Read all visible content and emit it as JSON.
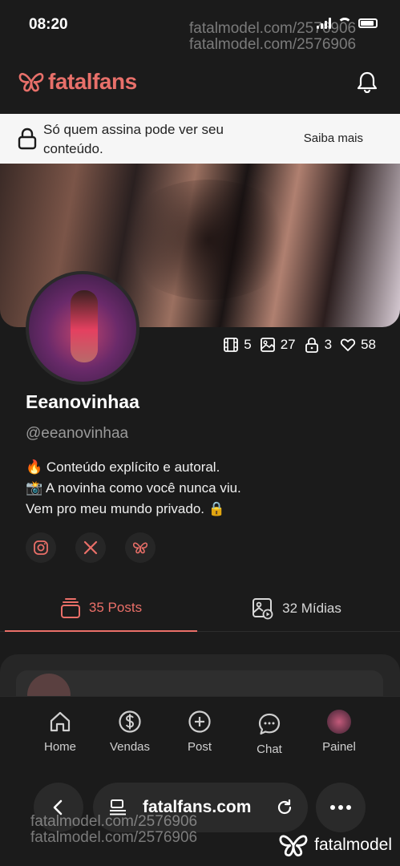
{
  "status_bar": {
    "time": "08:20"
  },
  "watermark": {
    "top_text": "fatalmodel.com/2576906",
    "bottom_text": "fatalmodel.com/2576906"
  },
  "header": {
    "logo_text": "fatalfans"
  },
  "lock_banner": {
    "text": "Só quem assina pode ver seu conteúdo.",
    "action": "Saiba mais"
  },
  "stats": {
    "videos": "5",
    "photos": "27",
    "locked": "3",
    "likes": "58"
  },
  "profile": {
    "name": "Eeanovinhaa",
    "handle": "@eeanovinhaa",
    "bio": [
      "🔥 Conteúdo explícito e autoral.",
      "📸 A novinha como você nunca viu.",
      "Vem pro meu mundo privado. 🔒"
    ]
  },
  "tabs": {
    "posts": "35 Posts",
    "midias": "32 Mídias"
  },
  "bottom_nav": {
    "home": "Home",
    "vendas": "Vendas",
    "post": "Post",
    "chat": "Chat",
    "painel": "Painel"
  },
  "browser": {
    "url": "fatalfans.com"
  },
  "brand_mark": {
    "text": "fatalmodel"
  },
  "colors": {
    "accent": "#ea6f68",
    "background": "#1b1b1b"
  }
}
